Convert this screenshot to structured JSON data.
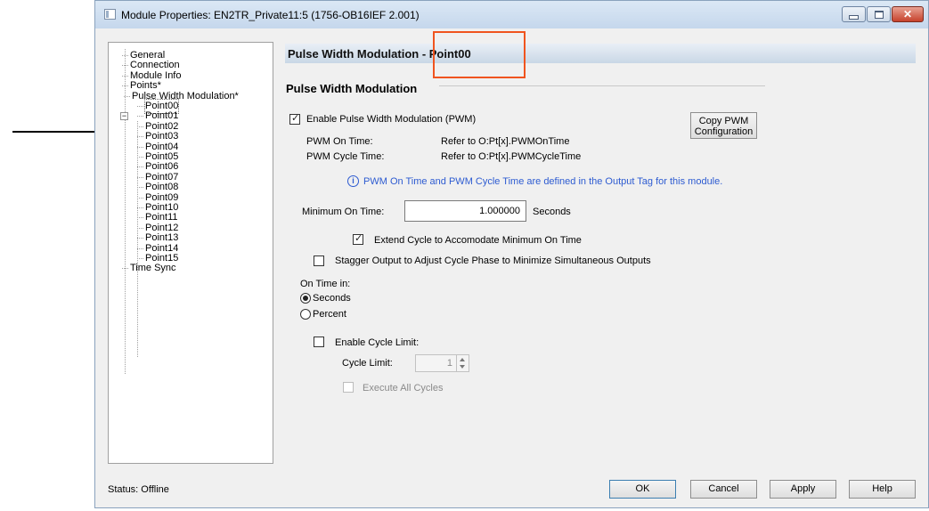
{
  "window": {
    "title": "Module Properties: EN2TR_Private11:5 (1756-OB16IEF 2.001)"
  },
  "tree": {
    "items": [
      "General",
      "Connection",
      "Module Info",
      "Points*",
      "Pulse Width Modulation*"
    ],
    "points": [
      "Point00",
      "Point01",
      "Point02",
      "Point03",
      "Point04",
      "Point05",
      "Point06",
      "Point07",
      "Point08",
      "Point09",
      "Point10",
      "Point11",
      "Point12",
      "Point13",
      "Point14",
      "Point15"
    ],
    "last": "Time Sync",
    "selected": "Point00"
  },
  "header": {
    "title": "Pulse Width Modulation - Point00"
  },
  "group": {
    "title": "Pulse Width Modulation"
  },
  "pwm": {
    "enable_label": "Enable Pulse Width Modulation (PWM)",
    "enable_checked": true,
    "copy_button_line1": "Copy PWM",
    "copy_button_line2": "Configuration",
    "on_time_label": "PWM On Time:",
    "on_time_value": "Refer to O:Pt[x].PWMOnTime",
    "cycle_time_label": "PWM Cycle Time:",
    "cycle_time_value": "Refer to O:Pt[x].PWMCycleTime",
    "info_text": "PWM On Time and PWM Cycle Time are defined in the Output Tag for this module.",
    "min_on_time_label": "Minimum On Time:",
    "min_on_time_value": "1.000000",
    "min_on_time_unit": "Seconds",
    "extend_cycle_label": "Extend Cycle to Accomodate Minimum On Time",
    "extend_cycle_checked": true,
    "stagger_label": "Stagger Output to Adjust Cycle Phase to Minimize Simultaneous  Outputs",
    "stagger_checked": false,
    "on_time_in_label": "On Time in:",
    "radio_seconds": "Seconds",
    "radio_percent": "Percent",
    "selected_unit": "Seconds",
    "enable_cycle_limit_label": "Enable Cycle Limit:",
    "enable_cycle_limit_checked": false,
    "cycle_limit_label": "Cycle Limit:",
    "cycle_limit_value": "1",
    "execute_all_label": "Execute All Cycles"
  },
  "status": {
    "text": "Status:  Offline"
  },
  "buttons": {
    "ok": "OK",
    "cancel": "Cancel",
    "apply": "Apply",
    "help": "Help"
  },
  "colors": {
    "highlight_box": "#f0541f",
    "info_blue": "#2d5bd1"
  }
}
